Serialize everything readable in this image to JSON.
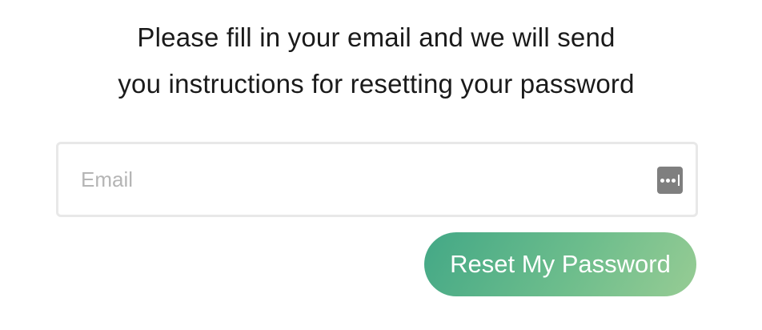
{
  "instructions": {
    "line1": "Please fill in your email and we will send",
    "line2": "you instructions for resetting your password"
  },
  "email_field": {
    "placeholder": "Email",
    "value": "",
    "password_manager_icon": "password-manager-icon"
  },
  "reset_button": {
    "label": "Reset My Password"
  },
  "colors": {
    "button_gradient_start": "#43a886",
    "button_gradient_end": "#97cc94",
    "input_border": "#e8e8e8",
    "placeholder": "#b5b5b5",
    "text": "#1a1a1a"
  }
}
